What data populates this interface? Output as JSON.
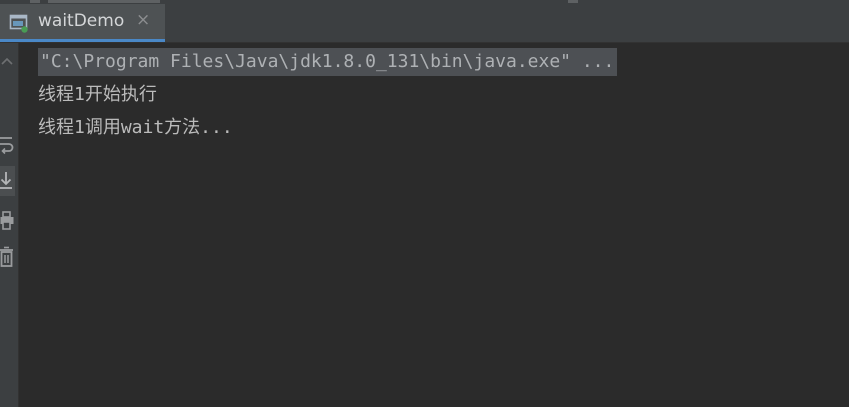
{
  "tab": {
    "label": "waitDemo",
    "close_glyph": "×",
    "icon": "run-console-icon"
  },
  "gutter": {
    "icons": [
      "chevron-up-icon",
      "soft-wrap-icon",
      "scroll-to-end-icon",
      "print-icon",
      "clear-all-icon"
    ]
  },
  "console": {
    "lines": [
      "\"C:\\Program Files\\Java\\jdk1.8.0_131\\bin\\java.exe\" ...",
      "线程1开始执行",
      "线程1调用wait方法..."
    ]
  },
  "colors": {
    "background": "#2b2b2b",
    "panel": "#3c3f41",
    "tab_active": "#4e5254",
    "tab_underline": "#4a88c7",
    "text": "#bbbbbb",
    "highlight": "#4d5054"
  }
}
